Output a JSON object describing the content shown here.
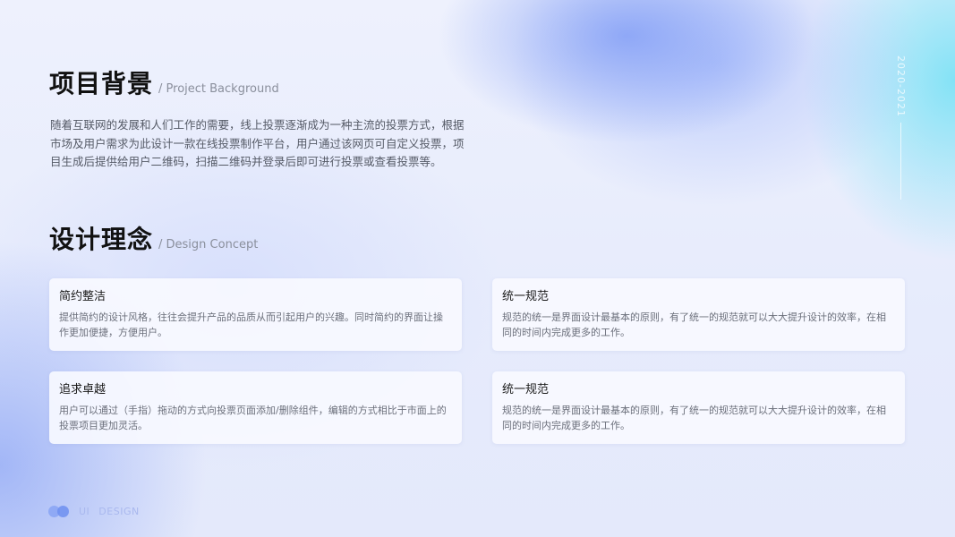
{
  "background_section": {
    "title": "项目背景",
    "subtitle": "/ Project Background",
    "paragraph": "随着互联网的发展和人们工作的需要，线上投票逐渐成为一种主流的投票方式，根据市场及用户需求为此设计一款在线投票制作平台，用户通过该网页可自定义投票，项目生成后提供给用户二维码，扫描二维码并登录后即可进行投票或查看投票等。"
  },
  "concept_section": {
    "title": "设计理念",
    "subtitle": "/ Design Concept",
    "cards": [
      {
        "title": "简约整洁",
        "text": "提供简约的设计风格，往往会提升产品的品质从而引起用户的兴趣。同时简约的界面让操作更加便捷，方便用户。"
      },
      {
        "title": "统一规范",
        "text": "规范的统一是界面设计最基本的原则，有了统一的规范就可以大大提升设计的效率，在相同的时间内完成更多的工作。"
      },
      {
        "title": "追求卓越",
        "text": "用户可以通过（手指）拖动的方式向投票页面添加/删除组件，编辑的方式相比于市面上的投票项目更加灵活。"
      },
      {
        "title": "统一规范",
        "text": "规范的统一是界面设计最基本的原则，有了统一的规范就可以大大提升设计的效率，在相同的时间内完成更多的工作。"
      }
    ]
  },
  "side": {
    "year_range": "2020-2021"
  },
  "footer": {
    "label_ui": "UI",
    "label_design": "DESIGN"
  },
  "colors": {
    "accent": "#6d8ff0",
    "card_bg": "#f8faff",
    "cyan_glow": "#78e1f5"
  }
}
